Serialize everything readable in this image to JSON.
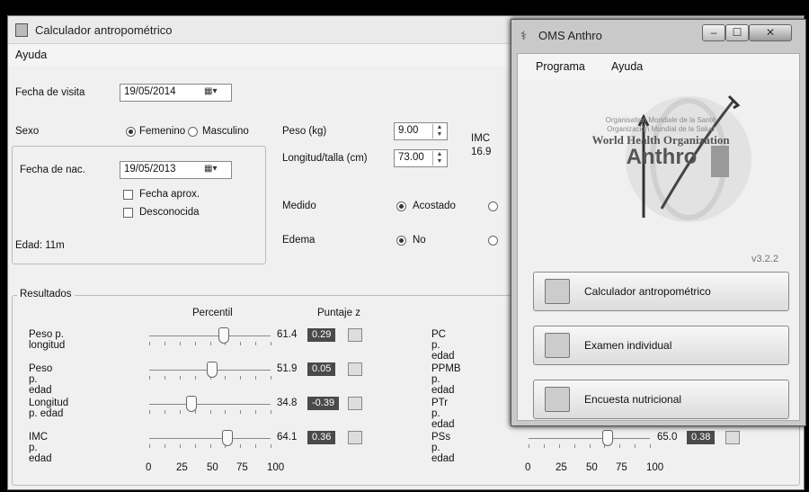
{
  "main_window": {
    "title": "Calculador antropométrico",
    "menu": [
      "Ayuda"
    ],
    "visit_date_label": "Fecha de visita",
    "visit_date": "19/05/2014",
    "sex_label": "Sexo",
    "sex_options": [
      "Femenino",
      "Masculino"
    ],
    "sex_selected": "Femenino",
    "birth_date_label": "Fecha de nac.",
    "birth_date": "19/05/2013",
    "approx_date_label": "Fecha aprox.",
    "unknown_label": "Desconocida",
    "age_text": "Edad: 11m",
    "weight_label": "Peso (kg)",
    "weight_value": "9.00",
    "length_label": "Longitud/talla (cm)",
    "length_value": "73.00",
    "bmi_label": "IMC",
    "bmi_value": "16.9",
    "measured_label": "Medido",
    "measured_option": "Acostado",
    "edema_label": "Edema",
    "edema_option": "No",
    "results_title": "Resultados",
    "percentile_header": "Percentil",
    "zscore_header": "Puntaje z",
    "left_results": [
      {
        "label": "Peso p. longitud",
        "percentile": "61.4",
        "z": "0.29",
        "slider": 0.614
      },
      {
        "label": "Peso p. edad",
        "percentile": "51.9",
        "z": "0.05",
        "slider": 0.519
      },
      {
        "label": "Longitud p. edad",
        "percentile": "34.8",
        "z": "-0.39",
        "slider": 0.348
      },
      {
        "label": "IMC p. edad",
        "percentile": "64.1",
        "z": "0.36",
        "slider": 0.641
      }
    ],
    "right_results": [
      {
        "label": "PC p. edad"
      },
      {
        "label": "PPMB p. edad"
      },
      {
        "label": "PTr p. edad"
      },
      {
        "label": "PSs p. edad",
        "percentile": "65.0",
        "z": "0.38",
        "slider": 0.65
      }
    ],
    "scale_labels": [
      "0",
      "25",
      "50",
      "75",
      "100"
    ]
  },
  "popup_window": {
    "title": "OMS Anthro",
    "menu": [
      "Programa",
      "Ayuda"
    ],
    "logo_line1": "Organisation Mondiale de la Santé",
    "logo_line2": "Organización Mundial de la Salud",
    "logo_line3": "World Health Organization",
    "logo_line4": "Anthro",
    "version": "v3.2.2",
    "buttons": [
      "Calculador antropométrico",
      "Examen individual",
      "Encuesta nutricional"
    ]
  }
}
